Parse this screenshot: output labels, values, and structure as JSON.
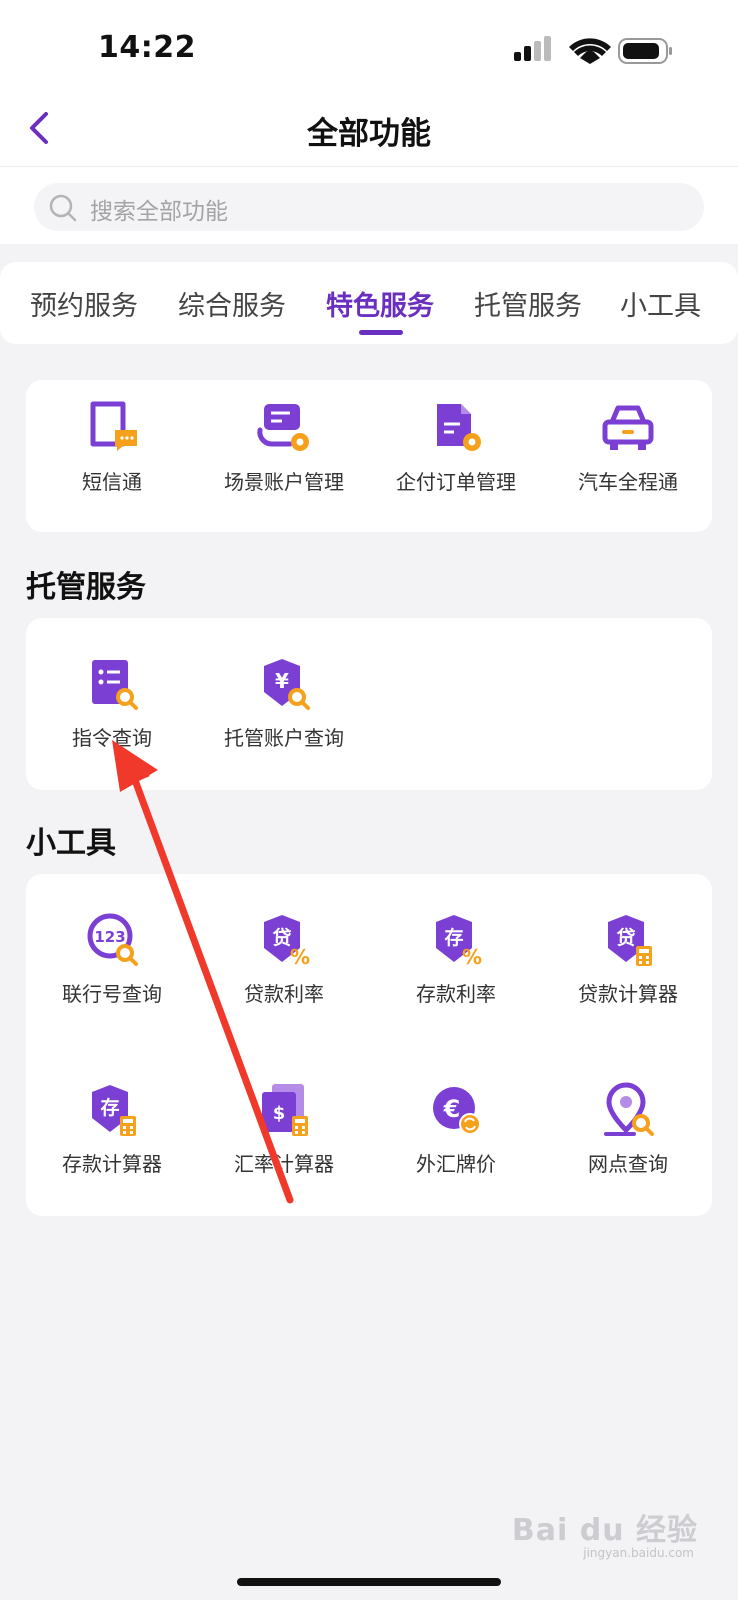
{
  "status_bar": {
    "time": "14:22"
  },
  "header": {
    "title": "全部功能",
    "back_icon": "chevron-left-icon"
  },
  "search": {
    "placeholder": "搜索全部功能"
  },
  "tabs": [
    {
      "label": "预约服务",
      "active": false
    },
    {
      "label": "综合服务",
      "active": false
    },
    {
      "label": "特色服务",
      "active": true
    },
    {
      "label": "托管服务",
      "active": false
    },
    {
      "label": "小工具",
      "active": false
    }
  ],
  "featured": {
    "items": [
      {
        "label": "短信通",
        "icon": "sms-document-icon"
      },
      {
        "label": "场景账户管理",
        "icon": "scene-account-settings-icon"
      },
      {
        "label": "企付订单管理",
        "icon": "order-document-settings-icon"
      },
      {
        "label": "汽车全程通",
        "icon": "car-icon"
      }
    ]
  },
  "custody": {
    "title": "托管服务",
    "items": [
      {
        "label": "指令查询",
        "icon": "instruction-search-icon"
      },
      {
        "label": "托管账户查询",
        "icon": "custody-account-search-icon"
      }
    ]
  },
  "tools": {
    "title": "小工具",
    "items": [
      {
        "label": "联行号查询",
        "icon": "bank-number-search-icon"
      },
      {
        "label": "贷款利率",
        "icon": "loan-rate-icon",
        "glyph": "贷"
      },
      {
        "label": "存款利率",
        "icon": "deposit-rate-icon",
        "glyph": "存"
      },
      {
        "label": "贷款计算器",
        "icon": "loan-calculator-icon",
        "glyph": "贷"
      },
      {
        "label": "存款计算器",
        "icon": "deposit-calculator-icon",
        "glyph": "存"
      },
      {
        "label": "汇率计算器",
        "icon": "exchange-rate-calculator-icon"
      },
      {
        "label": "外汇牌价",
        "icon": "forex-quote-icon"
      },
      {
        "label": "网点查询",
        "icon": "branch-location-search-icon"
      }
    ]
  },
  "colors": {
    "accent": "#6a2fbf",
    "icon_purple": "#7b3fd4",
    "icon_orange": "#f5a11c",
    "arrow_red": "#f0392b"
  },
  "watermark": {
    "text": "Bai du 经验",
    "sub": "jingyan.baidu.com"
  }
}
